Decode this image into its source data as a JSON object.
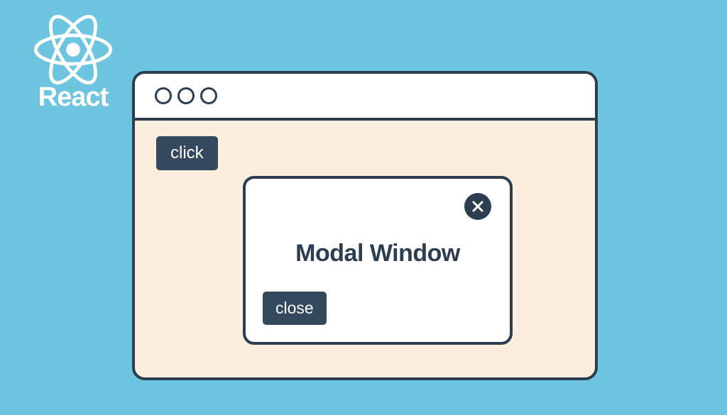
{
  "logo": {
    "text": "React"
  },
  "page": {
    "click_button_label": "click"
  },
  "modal": {
    "title": "Modal Window",
    "close_button_label": "close"
  }
}
